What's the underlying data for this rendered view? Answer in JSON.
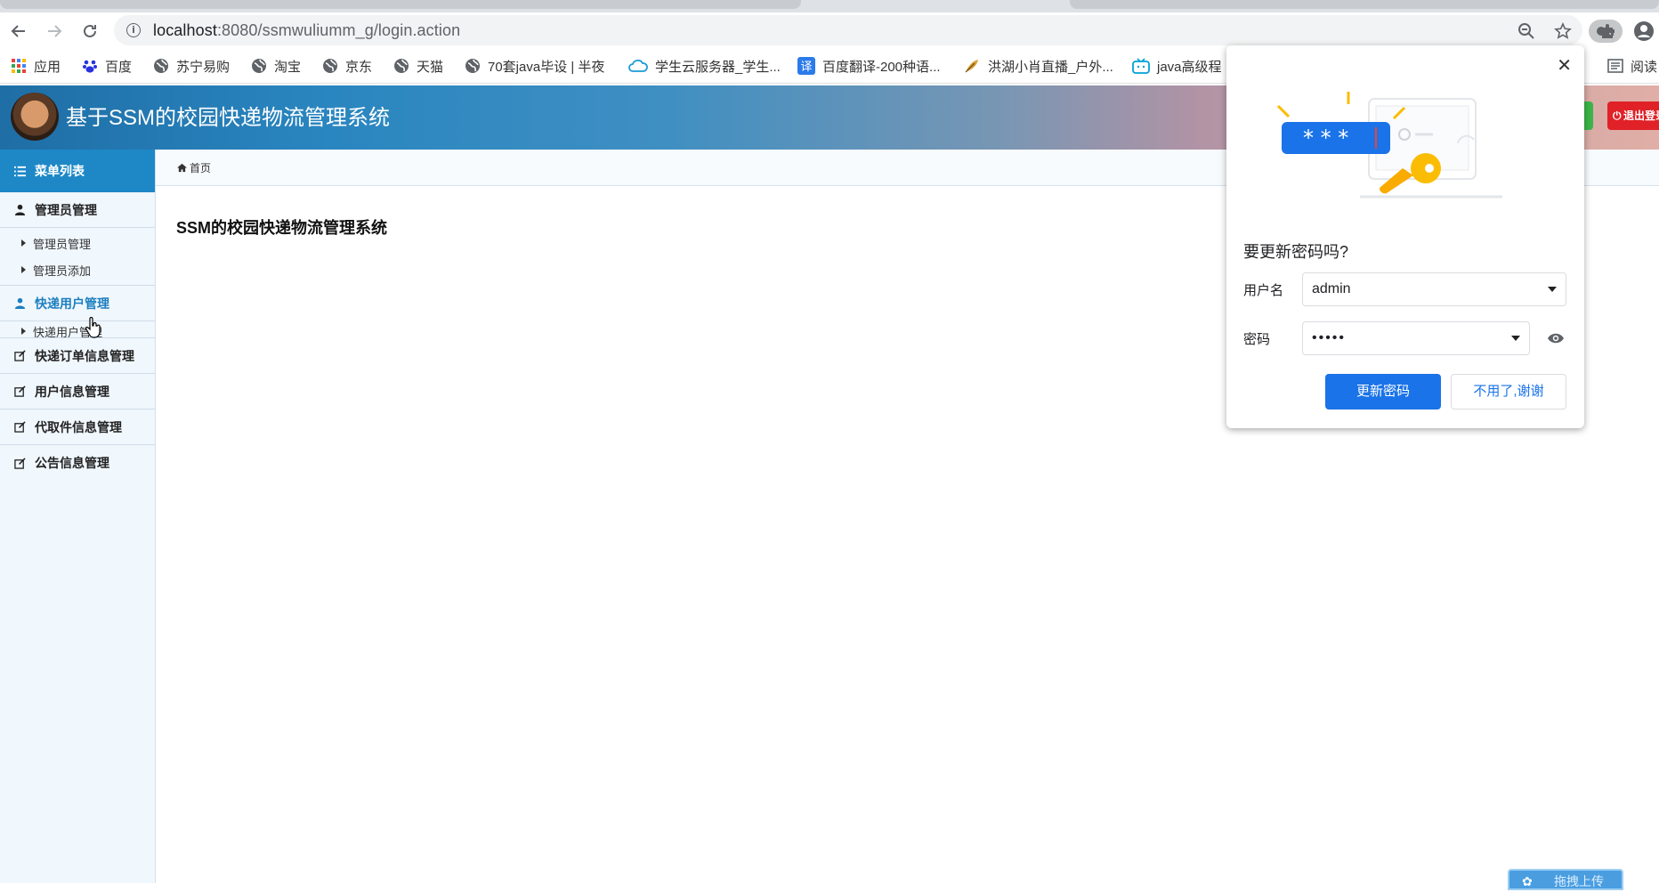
{
  "browser": {
    "url_host": "localhost",
    "url_rest": ":8080/ssmwuliumm_g/login.action",
    "bookmarks": [
      {
        "label": "应用",
        "icon": "apps-grid-icon",
        "color": "#4285f4"
      },
      {
        "label": "百度",
        "icon": "baidu-paw-icon",
        "color": "#2932e1"
      },
      {
        "label": "苏宁易购",
        "icon": "globe-icon",
        "color": "#5f6368"
      },
      {
        "label": "淘宝",
        "icon": "globe-icon",
        "color": "#5f6368"
      },
      {
        "label": "京东",
        "icon": "globe-icon",
        "color": "#5f6368"
      },
      {
        "label": "天猫",
        "icon": "globe-icon",
        "color": "#5f6368"
      },
      {
        "label": "70套java毕设 | 半夜",
        "icon": "globe-icon",
        "color": "#5f6368"
      },
      {
        "label": "学生云服务器_学生...",
        "icon": "cloud-icon",
        "color": "#1a9bd7"
      },
      {
        "label": "百度翻译-200种语...",
        "icon": "translate-icon",
        "color": "#2b7bea"
      },
      {
        "label": "洪湖小肖直播_户外...",
        "icon": "feather-icon",
        "color": "#c08a2a"
      },
      {
        "label": "java高级程",
        "icon": "bilibili-icon",
        "color": "#00a1d6"
      },
      {
        "label": "阅读",
        "icon": "reading-list-icon",
        "color": "#5f6368"
      }
    ]
  },
  "header": {
    "title": "基于SSM的校园快递物流管理系统",
    "logout_label": "退出登录"
  },
  "sidebar": {
    "head_label": "菜单列表",
    "groups": [
      {
        "label": "管理员管理",
        "subs": [
          "管理员管理",
          "管理员添加"
        ]
      },
      {
        "label": "快递用户管理",
        "subs": [
          "快递用户管理"
        ]
      },
      {
        "label": "快递订单信息管理",
        "subs": []
      },
      {
        "label": "用户信息管理",
        "subs": []
      },
      {
        "label": "代取件信息管理",
        "subs": []
      },
      {
        "label": "公告信息管理",
        "subs": []
      }
    ]
  },
  "main": {
    "breadcrumb": "首页",
    "title": "SSM的校园快递物流管理系统"
  },
  "corner_button": "拖拽上传",
  "popup": {
    "title": "要更新密码吗?",
    "username_label": "用户名",
    "username_value": "admin",
    "password_label": "密码",
    "password_value": "•••••",
    "update_label": "更新密码",
    "decline_label": "不用了,谢谢"
  }
}
